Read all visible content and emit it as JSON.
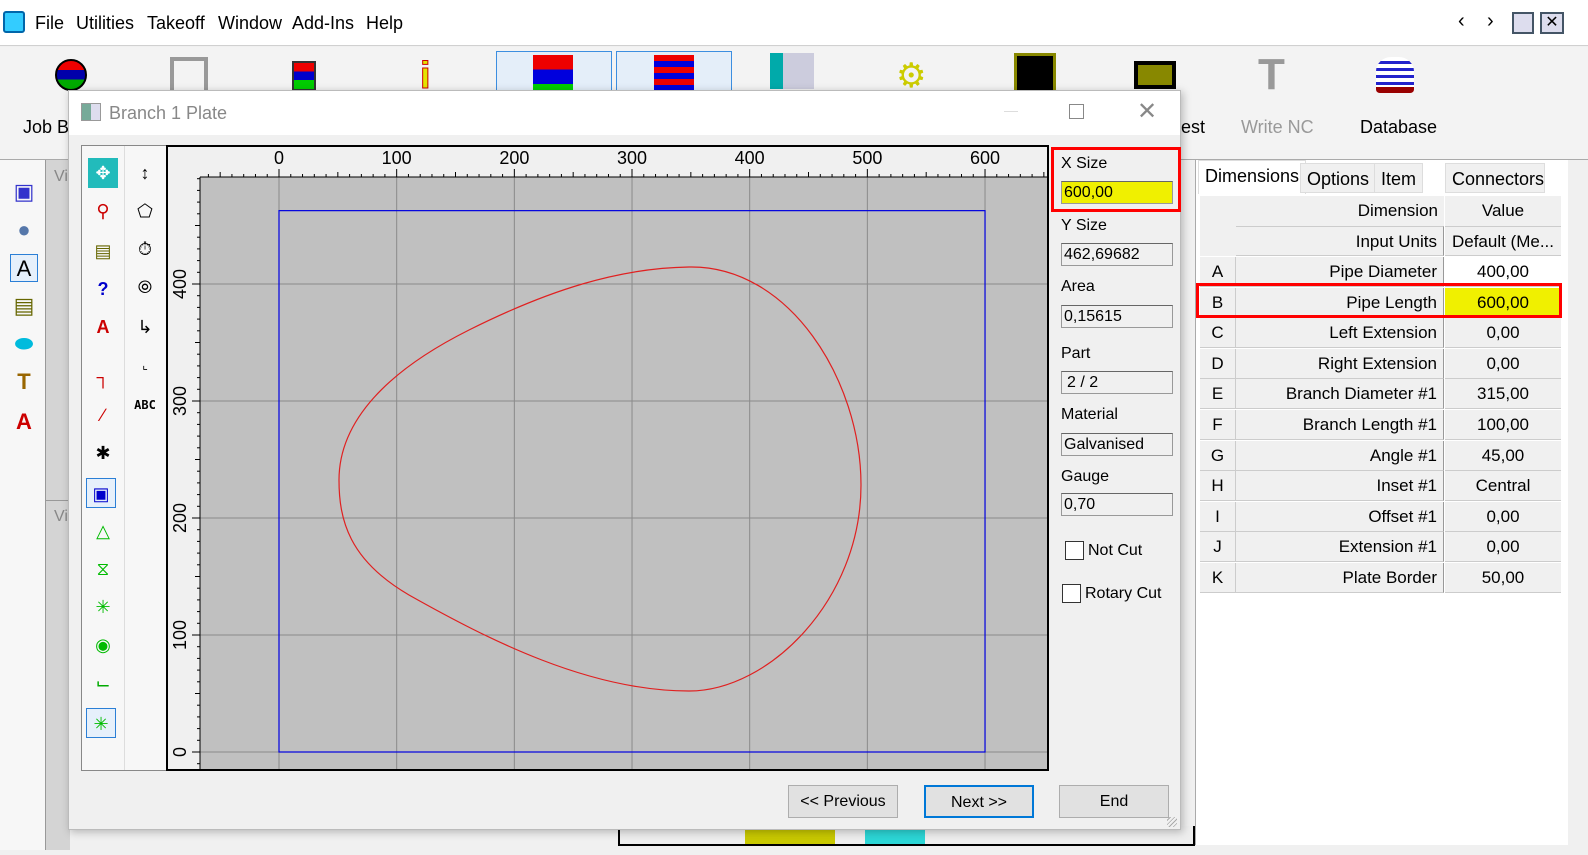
{
  "menu": {
    "items": [
      "File",
      "Utilities",
      "Takeoff",
      "Window",
      "Add-Ins",
      "Help"
    ]
  },
  "ribbon": {
    "labels": {
      "job": "Job Br",
      "nest": "est",
      "write_nc": "Write NC",
      "database": "Database"
    }
  },
  "side_panels": {
    "view_label_1": "Vi",
    "view_label_2": "Vi"
  },
  "dialog": {
    "title": "Branch 1 Plate",
    "x_ticks": [
      "0",
      "100",
      "200",
      "300",
      "400",
      "500",
      "600"
    ],
    "y_ticks": [
      "0",
      "100",
      "200",
      "300",
      "400"
    ],
    "fields": {
      "x_size_label": "X Size",
      "x_size": "600,00",
      "y_size_label": "Y Size",
      "y_size": "462,69682",
      "area_label": "Area",
      "area": "0,15615",
      "part_label": "Part",
      "part": "2 / 2",
      "material_label": "Material",
      "material": "Galvanised",
      "gauge_label": "Gauge",
      "gauge": "0,70"
    },
    "checkboxes": {
      "not_cut": "Not Cut",
      "rotary_cut": "Rotary Cut"
    },
    "buttons": {
      "previous": "<< Previous",
      "next": "Next >>",
      "end": "End"
    },
    "palette_text": "ABC"
  },
  "panel": {
    "tabs": [
      "Dimensions",
      "Options",
      "Item",
      "Connectors"
    ],
    "header": {
      "dimension": "Dimension",
      "value": "Value"
    },
    "input_units": {
      "label": "Input Units",
      "value": "Default (Me..."
    },
    "rows": [
      {
        "key": "A",
        "name": "Pipe Diameter",
        "value": "400,00"
      },
      {
        "key": "B",
        "name": "Pipe Length",
        "value": "600,00"
      },
      {
        "key": "C",
        "name": "Left Extension",
        "value": "0,00"
      },
      {
        "key": "D",
        "name": "Right Extension",
        "value": "0,00"
      },
      {
        "key": "E",
        "name": "Branch Diameter #1",
        "value": "315,00"
      },
      {
        "key": "F",
        "name": "Branch Length #1",
        "value": "100,00"
      },
      {
        "key": "G",
        "name": "Angle #1",
        "value": "45,00"
      },
      {
        "key": "H",
        "name": "Inset #1",
        "value": "Central"
      },
      {
        "key": "I",
        "name": "Offset #1",
        "value": "0,00"
      },
      {
        "key": "J",
        "name": "Extension #1",
        "value": "0,00"
      },
      {
        "key": "K",
        "name": "Plate Border",
        "value": "50,00"
      }
    ]
  },
  "colors": {
    "highlight": "#f0f000",
    "callout": "#ff0000",
    "curve": "#e02020",
    "plate": "#0000e0",
    "plot_bg": "#c0c0c0"
  }
}
